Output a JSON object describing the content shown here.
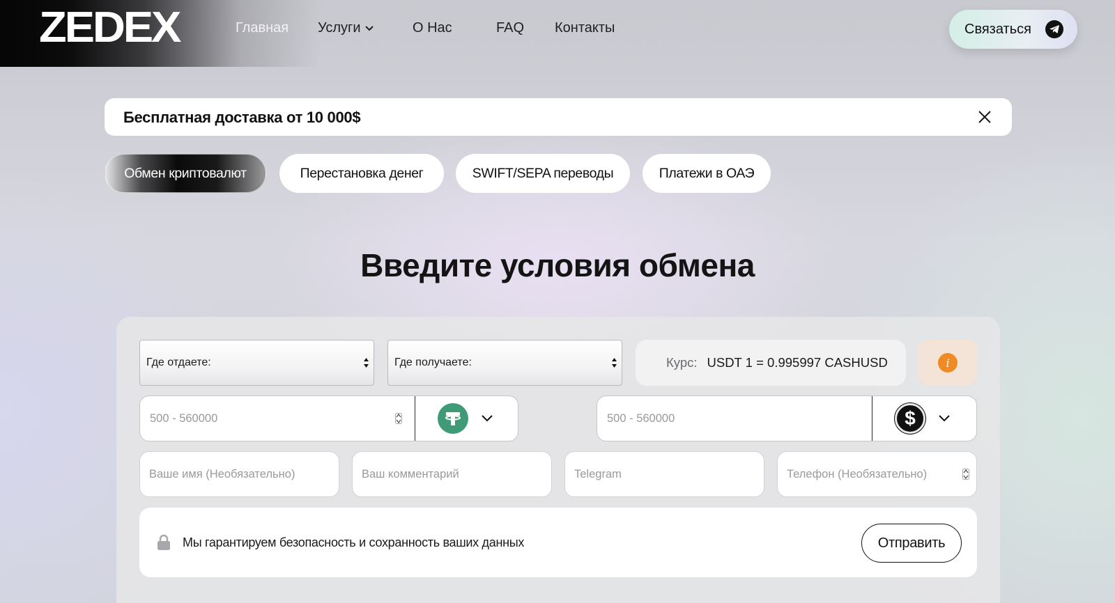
{
  "brand": {
    "logo": "ZEDEX"
  },
  "nav": {
    "home": "Главная",
    "services": "Услуги",
    "about": "О Нас",
    "faq": "FAQ",
    "contacts": "Контакты"
  },
  "header": {
    "contact_button": "Связаться",
    "contact_icon": "telegram-icon"
  },
  "banner": {
    "text": "Бесплатная доставка от 10 000$",
    "close_icon": "close-icon"
  },
  "tabs": [
    {
      "label": "Обмен криптовалют",
      "active": true
    },
    {
      "label": "Перестановка денег",
      "active": false
    },
    {
      "label": "SWIFT/SEPA переводы",
      "active": false
    },
    {
      "label": "Платежи в ОАЭ",
      "active": false
    }
  ],
  "section": {
    "title": "Введите условия обмена"
  },
  "form": {
    "give_where": "Где отдаете:",
    "receive_where": "Где получаете:",
    "rate_label": "Курс:",
    "rate_value": "USDT 1 = 0.995997 CASHUSD",
    "info_icon": "info-icon",
    "give_amount_placeholder": "500 - 560000",
    "give_currency_icon": "tether-icon",
    "receive_amount_placeholder": "500 - 560000",
    "receive_currency_icon": "dollar-icon",
    "name_placeholder": "Ваше имя (Необязательно)",
    "comment_placeholder": "Ваш комментарий",
    "telegram_placeholder": "Telegram",
    "phone_placeholder": "Телефон (Необязательно)",
    "security_text": "Мы гарантируем безопасность и сохранность ваших данных",
    "submit_label": "Отправить"
  },
  "colors": {
    "usdt": "#3f9a78",
    "info": "#f08a24",
    "info_bg": "#f3e4d7",
    "contact_gradient_start": "#d4efe6"
  }
}
